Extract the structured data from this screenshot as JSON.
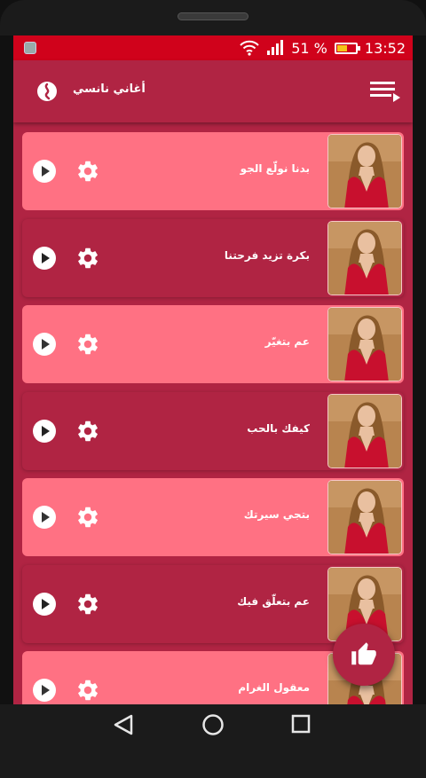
{
  "status_bar": {
    "battery_percent": "51 %",
    "time": "13:52",
    "battery_level": 0.51
  },
  "app_bar": {
    "title": "أغاني نانسي"
  },
  "songs": [
    {
      "title": "بدنا نولّع الجو",
      "style": "light"
    },
    {
      "title": "بكرة تزيد فرحتنا",
      "style": "dark"
    },
    {
      "title": "عم بتغيّر",
      "style": "light"
    },
    {
      "title": "كيفك بالحب",
      "style": "dark"
    },
    {
      "title": "بتجي سيرتك",
      "style": "light"
    },
    {
      "title": "عم بتعلّق فيك",
      "style": "dark"
    },
    {
      "title": "معقول الغرام",
      "style": "light"
    }
  ],
  "colors": {
    "primary": "#b02443",
    "card_light": "#ff7183",
    "status_bar": "#d0021b"
  },
  "icons": {
    "logo": "app-logo-icon",
    "menu": "playlist-menu-icon",
    "play": "play-icon",
    "settings": "gear-icon",
    "fab": "thumbs-up-icon"
  }
}
